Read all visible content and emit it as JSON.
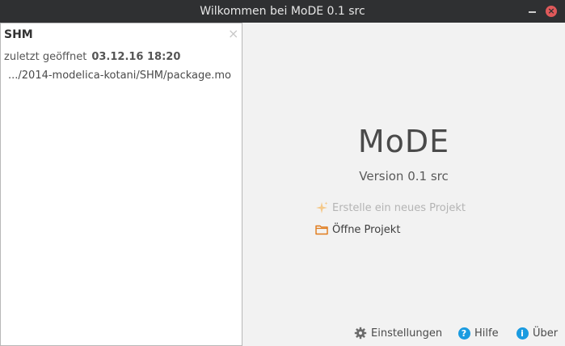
{
  "window": {
    "title": "Wilkommen bei MoDE 0.1 src",
    "close_glyph": "×"
  },
  "recent": {
    "title": "SHM",
    "close_glyph": "×",
    "opened_label": "zuletzt geöffnet",
    "opened_date": "03.12.16 18:20",
    "path": ".../2014-modelica-kotani/SHM/package.mo"
  },
  "welcome": {
    "app_name": "MoDE",
    "version": "Version 0.1 src",
    "new_project": "Erstelle ein neues Projekt",
    "open_project": "Öffne Projekt"
  },
  "footer": {
    "settings": "Einstellungen",
    "help": "Hilfe",
    "about": "Über",
    "help_glyph": "?",
    "about_glyph": "i"
  },
  "colors": {
    "titlebar": "#2f3032",
    "close_button": "#e0595a",
    "accent_orange": "#e07a1a",
    "info_blue": "#1a9be0"
  },
  "icons": {
    "new_project": "sparkle-icon",
    "open_project": "folder-icon",
    "settings": "gear-icon",
    "help": "help-icon",
    "about": "info-icon"
  }
}
